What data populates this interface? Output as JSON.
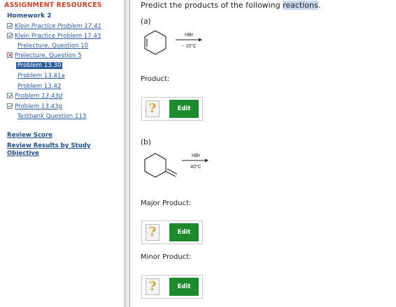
{
  "sidebar": {
    "header": "ASSIGNMENT RESOURCES",
    "assignment": "Homework 2",
    "items": [
      {
        "label": "Klein Practice Problem 17.41",
        "status": "check",
        "italic": true
      },
      {
        "label": "Klein Practice Problem 17.43",
        "status": "check",
        "italic": false
      },
      {
        "label": "Prelecture, Question 10",
        "status": "none",
        "italic": false
      },
      {
        "label": "Prelecture, Question 5",
        "status": "x",
        "italic": false
      },
      {
        "label": "Problem 13.30",
        "status": "selected",
        "italic": false
      },
      {
        "label": "Problem 13.41a",
        "status": "none",
        "italic": false
      },
      {
        "label": "Problem 13.42",
        "status": "none",
        "italic": false
      },
      {
        "label": "Problem 13.43d",
        "status": "check",
        "italic": true
      },
      {
        "label": "Problem 13.43g",
        "status": "check",
        "italic": false
      },
      {
        "label": "Testbank Question 113",
        "status": "none",
        "italic": false
      }
    ],
    "review_score": "Review Score",
    "review_results": "Review Results by Study Objective"
  },
  "main": {
    "prompt_pre": "Predict the products of the following ",
    "prompt_hl": "reactions",
    "prompt_post": ".",
    "part_a": {
      "label": "(a)",
      "reagent": "HBr",
      "condition": "− 15°C",
      "product_label": "Product:",
      "edit_label": "Edit",
      "placeholder": "?"
    },
    "part_b": {
      "label": "(b)",
      "reagent": "HBr",
      "condition": "40°C",
      "major_label": "Major Product:",
      "minor_label": "Minor Product:",
      "edit_label": "Edit",
      "placeholder": "?"
    }
  },
  "colors": {
    "header_red": "#c8452a",
    "link_blue": "#2b5aa3",
    "selected_bg": "#2d5e9e",
    "edit_green": "#1e8a2e",
    "highlight": "#c6d8ee"
  }
}
